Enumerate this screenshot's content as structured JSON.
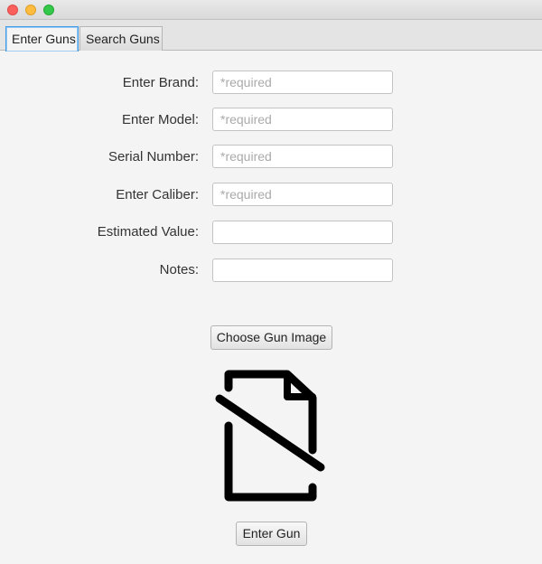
{
  "window": {
    "controls": [
      "close",
      "minimize",
      "maximize"
    ]
  },
  "tabs": [
    {
      "label": "Enter Guns",
      "active": true
    },
    {
      "label": "Search Guns",
      "active": false
    }
  ],
  "form": {
    "brand": {
      "label": "Enter Brand:",
      "value": "",
      "placeholder": "*required"
    },
    "model": {
      "label": "Enter Model:",
      "value": "",
      "placeholder": "*required"
    },
    "serial": {
      "label": "Serial Number:",
      "value": "",
      "placeholder": "*required"
    },
    "caliber": {
      "label": "Enter Caliber:",
      "value": "",
      "placeholder": "*required"
    },
    "value": {
      "label": "Estimated Value:",
      "value": "",
      "placeholder": ""
    },
    "notes": {
      "label": "Notes:",
      "value": "",
      "placeholder": ""
    }
  },
  "buttons": {
    "choose_image": "Choose Gun Image",
    "enter_gun": "Enter Gun"
  },
  "image_preview": {
    "icon": "no-image-icon"
  }
}
